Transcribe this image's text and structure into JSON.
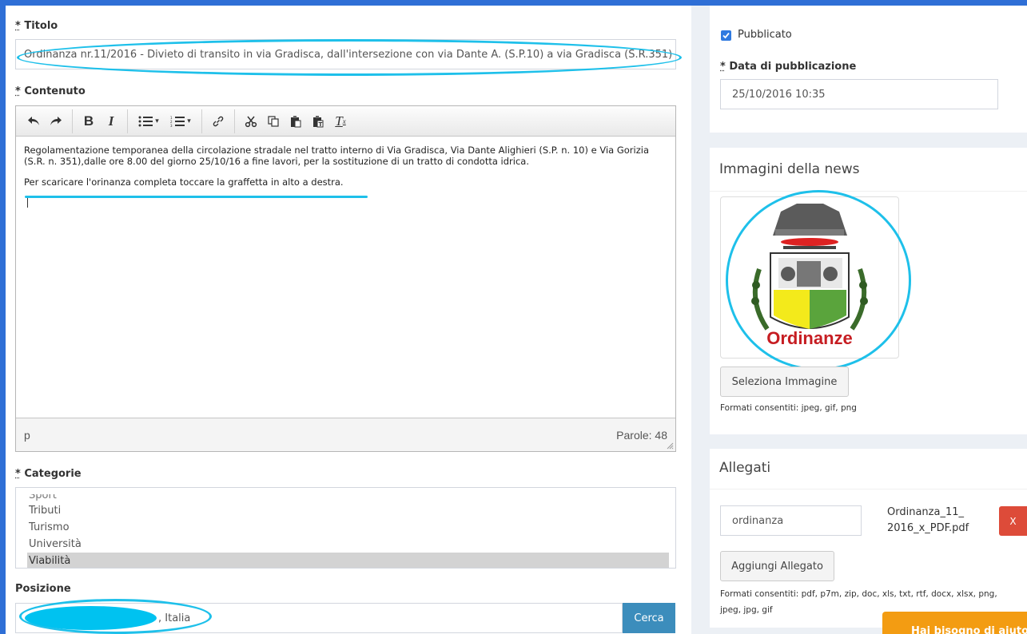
{
  "form": {
    "titolo_label": "Titolo",
    "titolo_value": "Ordinanza nr.11/2016 - Divieto di transito in via Gradisca, dall'intersezione con via Dante A. (S.P.10) a via Gradisca (S.R.351)",
    "contenuto_label": "Contenuto",
    "editor": {
      "paragraph1": "Regolamentazione temporanea della circolazione stradale nel tratto interno di Via Gradisca, Via Dante Alighieri (S.P. n. 10) e Via Gorizia (S.R. n. 351),dalle ore 8.00 del giorno 25/10/16 a fine lavori, per la sostituzione di un tratto di condotta idrica.",
      "paragraph2": "Per scaricare l'orinanza completa toccare la graffetta in alto a destra.",
      "status_path": "p",
      "word_count": "Parole: 48"
    },
    "categorie_label": "Categorie",
    "categorie_options": [
      "Sport",
      "Tributi",
      "Turismo",
      "Università",
      "Viabilità"
    ],
    "categorie_selected": "Viabilità",
    "posizione_label": "Posizione",
    "posizione_value": ", Italia",
    "cerca_label": "Cerca"
  },
  "publish": {
    "pubblicato_label": "Pubblicato",
    "pubblicato_checked": true,
    "data_label": "Data di pubblicazione",
    "data_value": "25/10/2016 10:35"
  },
  "images": {
    "title": "Immagini della news",
    "image_caption": "Ordinanze",
    "select_button": "Seleziona Immagine",
    "formats": "Formati consentiti: jpeg, gif, png"
  },
  "attachments": {
    "title": "Allegati",
    "name_value": "ordinanza",
    "file_name_line1": "Ordinanza_11_",
    "file_name_line2": "2016_x_PDF.pdf",
    "remove_label": "X",
    "add_button": "Aggiungi Allegato",
    "formats": "Formati consentiti: pdf, p7m, zip, doc, xls, txt, rtf, docx, xlsx, png, jpeg, jpg, gif"
  },
  "help_label": "Hai bisogno di aiuto?",
  "colors": {
    "frame": "#2f6fd6",
    "annotation": "#1ec0ea",
    "primary": "#3c8dbc",
    "danger": "#dd4b39",
    "help": "#f39c12"
  }
}
